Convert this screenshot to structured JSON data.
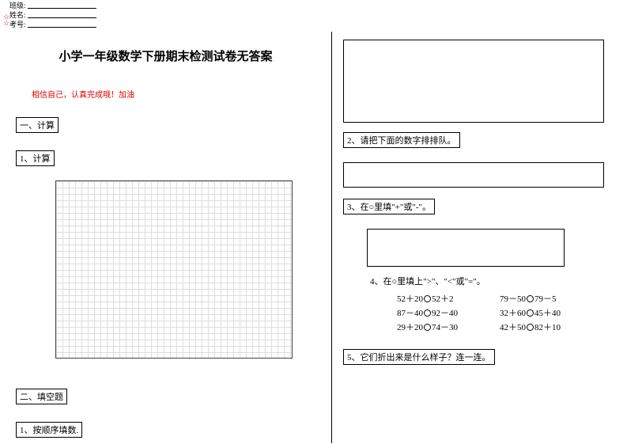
{
  "meta": {
    "label1": "班级:",
    "label2": "姓名:",
    "label3": "考号:"
  },
  "title": "小学一年级数学下册期末检测试卷无答案",
  "encouragement": "相信自己，认真完成哦！加油",
  "section1": {
    "heading": "一、计算",
    "sub1": "1、计算"
  },
  "section2": {
    "heading": "二、填空题",
    "sub1": "1、按顺序填数."
  },
  "right": {
    "q2": "2、请把下面的数字排排队。",
    "q3": "3、在○里填\"+\"或\"-\"。",
    "q4": {
      "title": "4、在○里填上\">\"、\"<\"或\"=\"。",
      "rows": [
        {
          "l_a": "52＋20",
          "l_b": "52＋2",
          "r_a": "79－50",
          "r_b": "79－5"
        },
        {
          "l_a": "87－40",
          "l_b": "92－40",
          "r_a": "32＋60",
          "r_b": "45＋40"
        },
        {
          "l_a": "29＋20",
          "l_b": "74－30",
          "r_a": "42＋50",
          "r_b": "82＋10"
        }
      ]
    },
    "q5": "5、它们折出来是什么样子？连一连。"
  }
}
